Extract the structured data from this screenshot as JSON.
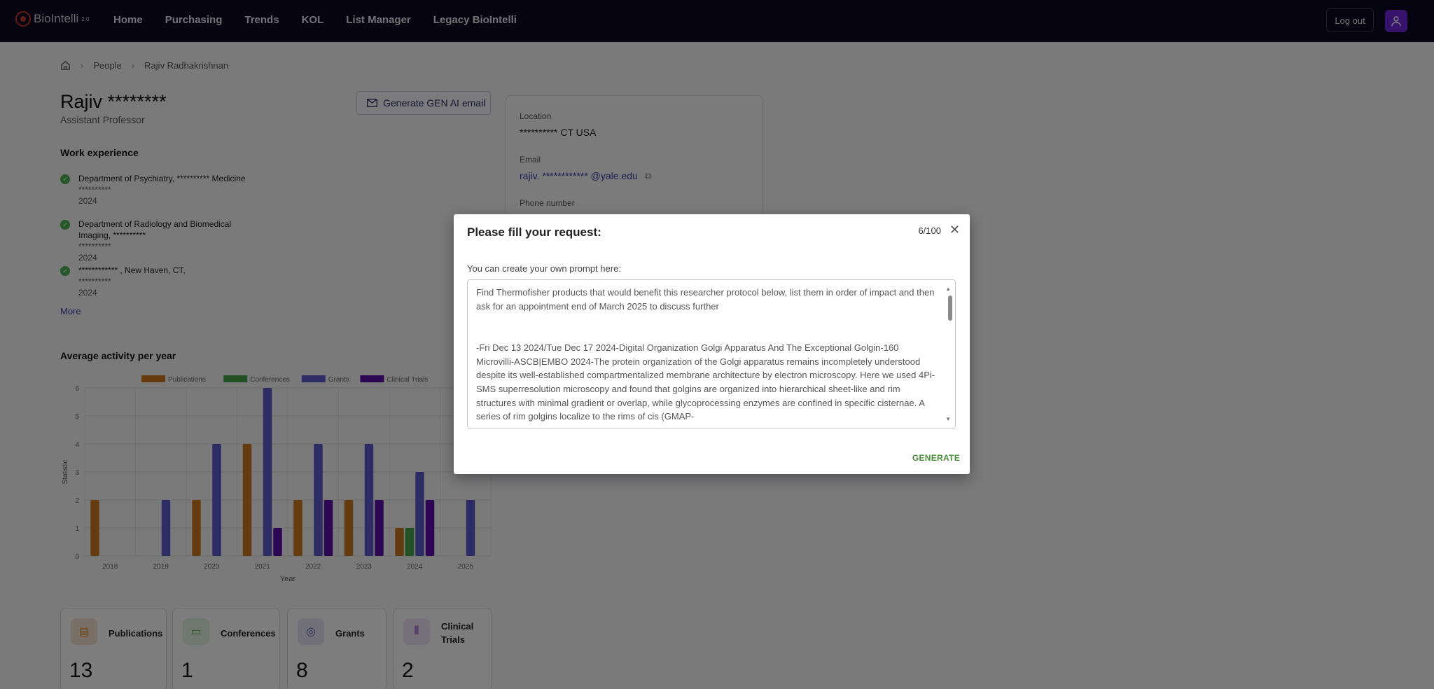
{
  "app": {
    "brand": "BioIntelli",
    "brand_version": "2.0"
  },
  "nav": [
    "Home",
    "Purchasing",
    "Trends",
    "KOL",
    "List Manager",
    "Legacy BioIntelli"
  ],
  "header": {
    "logout": "Log out"
  },
  "breadcrumb": {
    "section": "People",
    "current": "Rajiv Radhakrishnan"
  },
  "profile": {
    "name": "Rajiv ********",
    "title": "Assistant Professor",
    "gen_button": "Generate GEN AI email"
  },
  "work": {
    "heading": "Work experience",
    "items": [
      {
        "line": "Department of Psychiatry,  ********** Medicine",
        "sub": "**********",
        "year": "2024"
      },
      {
        "line": "Department of Radiology and Biomedical Imaging,  **********",
        "sub": "**********",
        "year": "2024"
      },
      {
        "line": "************ , New Haven, CT,",
        "sub": "**********",
        "year": "2024"
      }
    ],
    "more": "More"
  },
  "contact": {
    "location_label": "Location",
    "location_value": "**********   CT USA",
    "email_label": "Email",
    "email_value": "rajiv.  ************  @yale.edu",
    "phone_label": "Phone number"
  },
  "activity": {
    "heading": "Average activity per year"
  },
  "stats": [
    {
      "label": "Publications",
      "value": "13",
      "icon": "document-icon",
      "color": "#f3e3cf",
      "icolor": "#d98b2e"
    },
    {
      "label": "Conferences",
      "value": "1",
      "icon": "presentation-icon",
      "color": "#dff0df",
      "icolor": "#4caf50"
    },
    {
      "label": "Grants",
      "value": "8",
      "icon": "medal-icon",
      "color": "#e4e3f3",
      "icolor": "#5b57b0"
    },
    {
      "label": "Clinical Trials",
      "value": "2",
      "icon": "test-tubes-icon",
      "color": "#ece0f5",
      "icolor": "#7b2fbe"
    }
  ],
  "chart_data": {
    "type": "bar",
    "categories": [
      "2018",
      "2019",
      "2020",
      "2021",
      "2022",
      "2023",
      "2024",
      "2025"
    ],
    "series": [
      {
        "name": "Publications",
        "color": "#c8791f",
        "values": [
          2,
          0,
          2,
          4,
          2,
          2,
          1,
          0
        ]
      },
      {
        "name": "Conferences",
        "color": "#45a547",
        "values": [
          0,
          0,
          0,
          0,
          0,
          0,
          1,
          0
        ]
      },
      {
        "name": "Grants",
        "color": "#5c59c9",
        "values": [
          0,
          2,
          4,
          6,
          4,
          4,
          3,
          2
        ]
      },
      {
        "name": "Clinical Trials",
        "color": "#5b0fa8",
        "values": [
          0,
          0,
          0,
          1,
          2,
          2,
          2,
          0
        ]
      }
    ],
    "xlabel": "Year",
    "ylabel": "Statistic",
    "ylim": [
      0,
      6
    ],
    "yticks": [
      0,
      1,
      2,
      3,
      4,
      5,
      6
    ],
    "grid": true,
    "legend": "top"
  },
  "modal": {
    "title": "Please fill your request:",
    "counter": "6/100",
    "prompt_label": "You can create your own prompt here:",
    "prompt_text": "Find Thermofisher products that would benefit this researcher protocol below, list them in order of impact and then ask for an appointment end of March 2025 to discuss further\n\n\n-Fri Dec 13 2024/Tue Dec 17 2024-Digital Organization Golgi Apparatus And The Exceptional Golgin-160 Microvilli-ASCB|EMBO 2024-The protein organization of the Golgi apparatus remains incompletely understood despite its well-established compartmentalized membrane architecture by electron microscopy. Here we used 4Pi-SMS superresolution microscopy and found that golgins are organized into hierarchical sheet-like and rim structures with minimal gradient or overlap, while glycoprocessing enzymes are confined in specific cisternae. A series of rim golgins localize to the rims of cis (GMAP-",
    "generate": "GENERATE"
  }
}
